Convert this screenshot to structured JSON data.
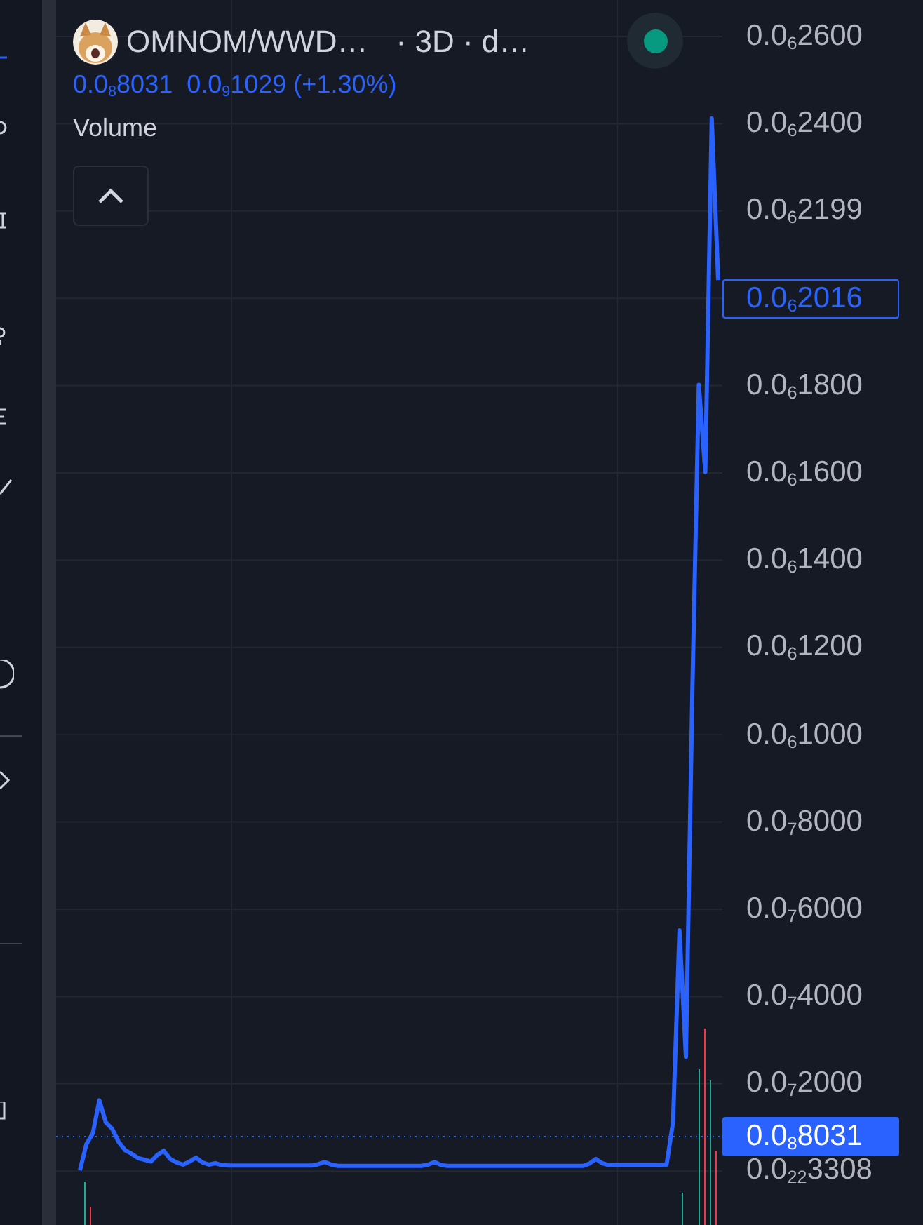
{
  "header": {
    "symbol": "OMNOM/WWD…",
    "interval": "· 3D · d…",
    "status": {
      "color": "#089981"
    },
    "ohlc": [
      "0.0$_{8}$8031",
      "0.0$_{9}$1029 (+1.30%)"
    ],
    "indicator": "Volume",
    "collapsed": false
  },
  "price_axis": [
    {
      "kind": "tick",
      "label": "0.0$_{6}$2600"
    },
    {
      "kind": "tick",
      "label": "0.0$_{6}$2400"
    },
    {
      "kind": "tick",
      "label": "0.0$_{6}$2199"
    },
    {
      "kind": "last_value",
      "label": "0.0$_{6}$2016"
    },
    {
      "kind": "tick",
      "label": "0.0$_{6}$1800"
    },
    {
      "kind": "tick",
      "label": "0.0$_{6}$1600"
    },
    {
      "kind": "tick",
      "label": "0.0$_{6}$1400"
    },
    {
      "kind": "tick",
      "label": "0.0$_{6}$1200"
    },
    {
      "kind": "tick",
      "label": "0.0$_{6}$1000"
    },
    {
      "kind": "tick",
      "label": "0.0$_{7}$8000"
    },
    {
      "kind": "tick",
      "label": "0.0$_{7}$6000"
    },
    {
      "kind": "tick",
      "label": "0.0$_{7}$4000"
    },
    {
      "kind": "tick",
      "label": "0.0$_{7}$2000"
    },
    {
      "kind": "tick",
      "label": "0.0$_{22}$3308"
    }
  ],
  "current_price": "0.0$_{8}$8031"
}
